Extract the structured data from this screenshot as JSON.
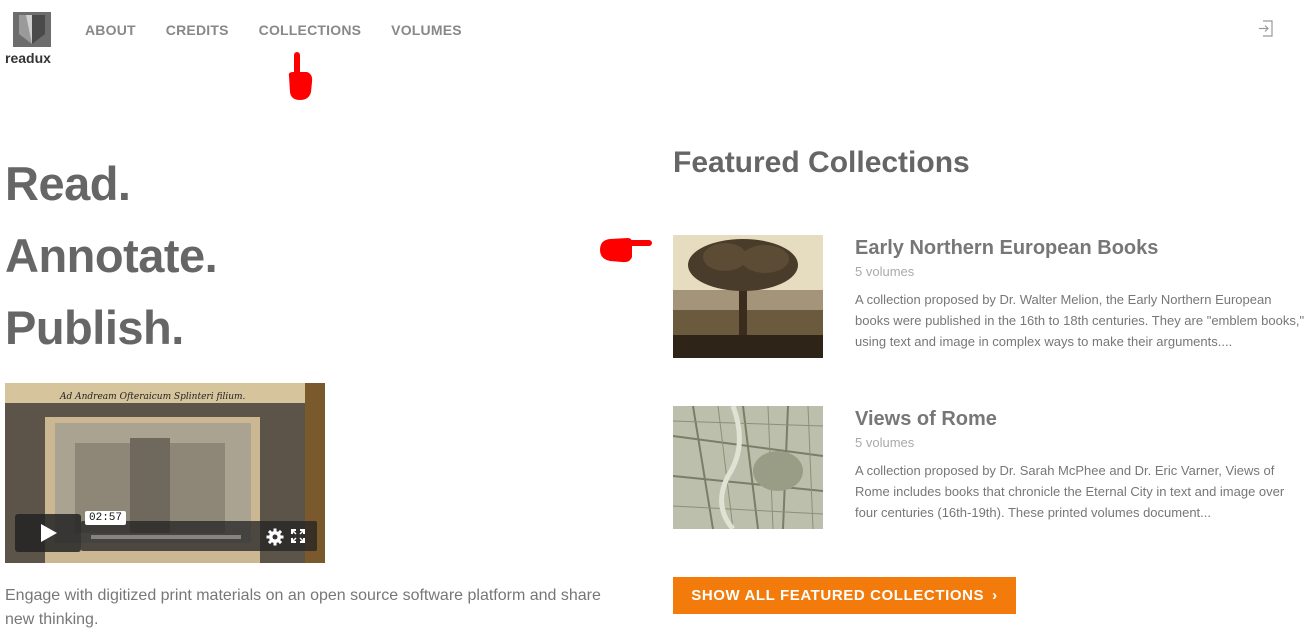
{
  "brand": {
    "name": "readux"
  },
  "nav": {
    "items": [
      "ABOUT",
      "CREDITS",
      "COLLECTIONS",
      "VOLUMES"
    ]
  },
  "hero": {
    "lines": [
      "Read.",
      "Annotate.",
      "Publish."
    ]
  },
  "video": {
    "caption": "Ad Andream Ofteraicum Splinteri filium.",
    "time": "02:57"
  },
  "tagline": "Engage with digitized print materials on an open source software platform and share new thinking.",
  "featured": {
    "title": "Featured Collections",
    "collections": [
      {
        "name": "Early Northern European Books",
        "count": "5 volumes",
        "description": "A collection proposed by Dr. Walter Melion, the Early Northern European books were published in the 16th to 18th centuries. They are \"emblem books,\" using text and image in complex ways to make their arguments...."
      },
      {
        "name": "Views of Rome",
        "count": "5 volumes",
        "description": "A collection proposed by Dr. Sarah McPhee and Dr. Eric Varner, Views of Rome includes books that chronicle the Eternal City in text and image over four centuries (16th-19th). These printed volumes document..."
      }
    ],
    "show_all_label": "SHOW ALL FEATURED COLLECTIONS",
    "show_all_chevron": "›"
  },
  "colors": {
    "accent": "#f37b0b",
    "annotation": "#ff0000",
    "text": "#666666"
  }
}
